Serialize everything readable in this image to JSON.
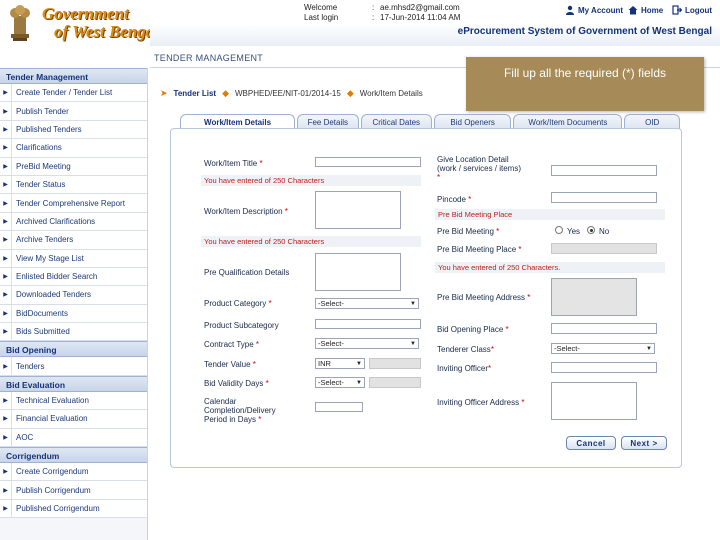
{
  "header": {
    "logo_line1": "Government",
    "logo_line2": "of West Bengal",
    "welcome_label": "Welcome",
    "welcome_sep": ":",
    "welcome_value": "ae.mhsd2@gmail.com",
    "lastlogin_label": "Last login",
    "lastlogin_sep": ":",
    "lastlogin_value": "17-Jun-2014 11:04 AM",
    "links": {
      "my_account": "My Account",
      "home": "Home",
      "logout": "Logout"
    },
    "system_title": "eProcurement System of Government of West Bengal"
  },
  "page": {
    "heading": "TENDER MANAGEMENT"
  },
  "sidebar": {
    "sections": [
      {
        "title": "Tender Management",
        "items": [
          "Create Tender / Tender List",
          "Publish Tender",
          "Published Tenders",
          "Clarifications",
          "PreBid Meeting",
          "Tender Status",
          "Tender Comprehensive Report",
          "Archived Clarifications",
          "Archive Tenders",
          "View My Stage List",
          "Enlisted Bidder Search",
          "Downloaded Tenders",
          "BidDocuments",
          "Bids Submitted"
        ]
      },
      {
        "title": "Bid Opening",
        "items": [
          "Tenders"
        ]
      },
      {
        "title": "Bid Evaluation",
        "items": [
          "Technical Evaluation",
          "Financial Evaluation",
          "AOC"
        ]
      },
      {
        "title": "Corrigendum",
        "items": [
          "Create Corrigendum",
          "Publish Corrigendum",
          "Published Corrigendum"
        ]
      }
    ]
  },
  "breadcrumb": {
    "item1": "Tender List",
    "item2": "WBPHED/EE/NIT-01/2014-15",
    "item3": "Work/Item Details"
  },
  "tooltip": {
    "text": "Fill up all the required (*) fields"
  },
  "tabs": [
    "Work/Item Details",
    "Fee Details",
    "Critical Dates",
    "Bid Openers",
    "Work/Item Documents",
    "OID"
  ],
  "form": {
    "left": {
      "work_item_title": "Work/Item Title",
      "chars_note_1": "You have entered   of 250 Characters",
      "work_item_description": "Work/Item Description",
      "chars_note_2": "You have entered   of 250 Characters",
      "pre_qualification": "Pre Qualification Details",
      "product_category": "Product Category",
      "product_category_value": "-Select-",
      "product_subcategory": "Product Subcategory",
      "contract_type": "Contract Type",
      "contract_type_value": "-Select-",
      "tender_value": "Tender Value",
      "currency_value": "INR",
      "bid_validity": "Bid Validity Days",
      "bid_validity_value": "-Select-",
      "completion_period": "Calendar Completion/Delivery Period in Days"
    },
    "right": {
      "location_detail": "Give Location Detail (work / services / items)",
      "pincode": "Pincode",
      "prebid_heading": "Pre Bid Meeting Place",
      "prebid_meeting": "Pre Bid Meeting",
      "yes": "Yes",
      "no": "No",
      "prebid_place": "Pre Bid Meeting Place",
      "chars_note_3": "You have entered   of 250 Characters.",
      "prebid_address": "Pre Bid Meeting Address",
      "bid_opening_place": "Bid Opening Place",
      "tenderer_class": "Tenderer Class",
      "tenderer_class_value": "-Select-",
      "inviting_officer": "Inviting Officer",
      "inviting_officer_address": "Inviting Officer Address"
    },
    "required_mark": "*",
    "buttons": {
      "cancel": "Cancel",
      "next": "Next >"
    }
  },
  "colors": {
    "brand_blue": "#15337a",
    "required_red": "#d00000",
    "tooltip_bg": "#a68a57",
    "logo_gold": "#d98b10"
  }
}
